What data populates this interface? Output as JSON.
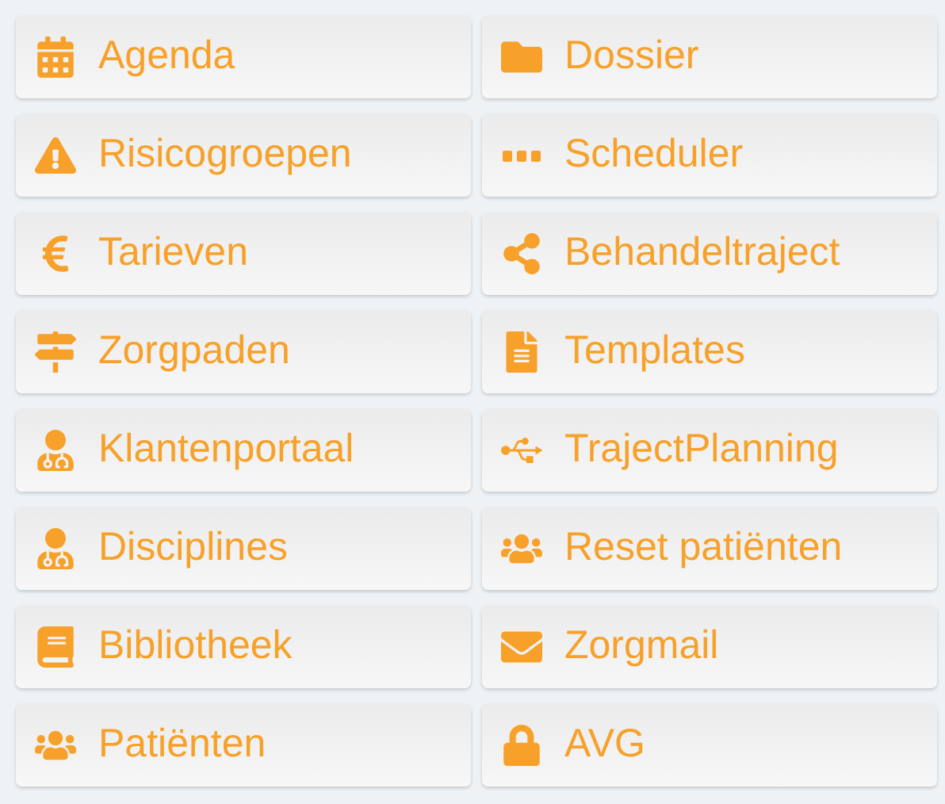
{
  "menu_buttons": [
    {
      "label": "Agenda"
    },
    {
      "label": "Dossier"
    },
    {
      "label": "Risicogroepen"
    },
    {
      "label": "Scheduler"
    },
    {
      "label": "Tarieven"
    },
    {
      "label": "Behandeltraject"
    },
    {
      "label": "Zorgpaden"
    },
    {
      "label": "Templates"
    },
    {
      "label": "Klantenportaal"
    },
    {
      "label": "TrajectPlanning"
    },
    {
      "label": "Disciplines"
    },
    {
      "label": "Reset patiënten"
    },
    {
      "label": "Bibliotheek"
    },
    {
      "label": "Zorgmail"
    },
    {
      "label": "Patiënten"
    },
    {
      "label": "AVG"
    }
  ]
}
